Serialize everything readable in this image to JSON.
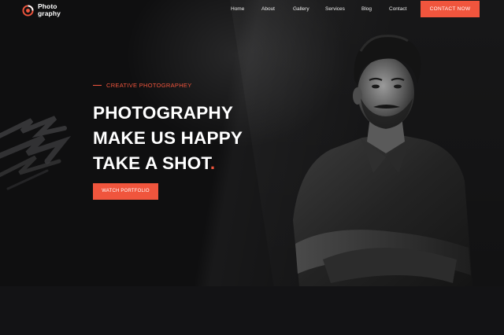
{
  "brand": {
    "logo_line1": "Photo",
    "logo_line2": "graphy",
    "accent_color": "#f0553d",
    "logo_icon": "aperture-ring-icon"
  },
  "nav": {
    "items": [
      "Home",
      "About",
      "Gallery",
      "Services",
      "Blog",
      "Contact"
    ],
    "cta_label": "CONTACT NOW"
  },
  "hero": {
    "eyebrow": "CREATIVE PHOTOGRAPHEY",
    "headline_line1": "PHOTOGRAPHY",
    "headline_line2": "MAKE US HAPPY",
    "headline_line3": "TAKE A SHOT",
    "headline_dot": ".",
    "button_label": "WATCH PORTFOLIO",
    "portrait_icon": "portrait-photo",
    "brush_icon": "brush-stroke-decoration"
  }
}
